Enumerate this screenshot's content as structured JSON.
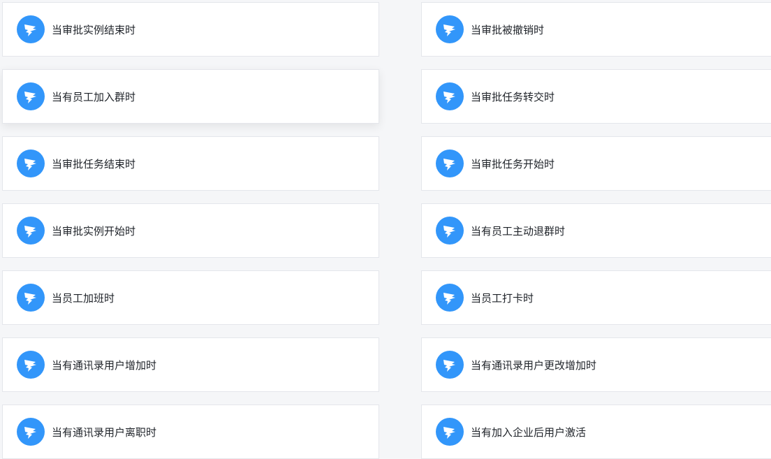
{
  "theme": {
    "accent": "#3296fa",
    "background": "#f5f6f8",
    "card_border": "#e4e6eb"
  },
  "icon_name": "dingtalk-logo-icon",
  "left_column": [
    {
      "label": "当审批实例结束时"
    },
    {
      "label": "当有员工加入群时"
    },
    {
      "label": "当审批任务结束时"
    },
    {
      "label": "当审批实例开始时"
    },
    {
      "label": "当员工加班时"
    },
    {
      "label": "当有通讯录用户增加时"
    },
    {
      "label": "当有通讯录用户离职时"
    }
  ],
  "right_column": [
    {
      "label": "当审批被撤销时"
    },
    {
      "label": "当审批任务转交时"
    },
    {
      "label": "当审批任务开始时"
    },
    {
      "label": "当有员工主动退群时"
    },
    {
      "label": "当员工打卡时"
    },
    {
      "label": "当有通讯录用户更改增加时"
    },
    {
      "label": "当有加入企业后用户激活"
    }
  ]
}
